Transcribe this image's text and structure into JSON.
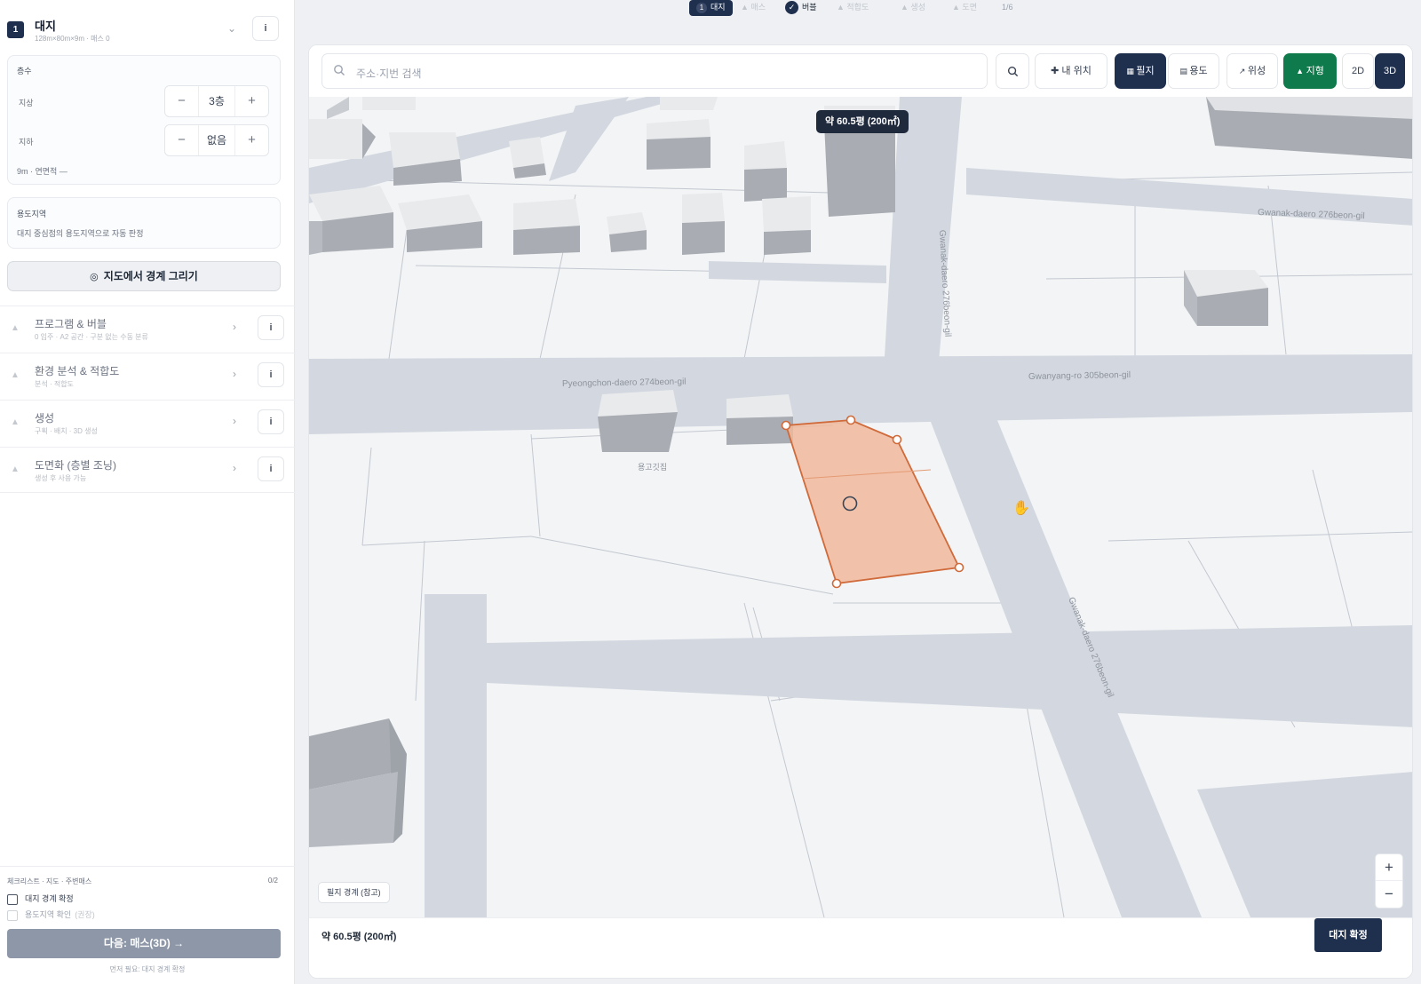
{
  "sidebar": {
    "step_number": "1",
    "section_title": "대지",
    "section_sub": "128m×80m×9m · 매스 0",
    "info_glyph": "i",
    "floors": {
      "title": "층수",
      "above_label": "지상",
      "above_value": "3층",
      "below_label": "지하",
      "below_value": "없음",
      "note": "9m · 연면적 —"
    },
    "zoning": {
      "title": "용도지역",
      "note": "대지 중심점의 용도지역으로 자동 판정"
    },
    "draw_button": "지도에서 경계 그리기",
    "nav_items": [
      {
        "title": "프로그램 & 버블",
        "sub": "0 입주 · A2 공간 · 구분 없는 수동 분류"
      },
      {
        "title": "환경 분석 & 적합도",
        "sub": "분석 · 적합도"
      },
      {
        "title": "생성",
        "sub": "구획 · 배치 · 3D 생성"
      },
      {
        "title": "도면화 (층별 조닝)",
        "sub": "생성 후 사용 가능"
      }
    ],
    "checklist": {
      "title": "체크리스트 · 지도 · 주변매스",
      "count": "0/2",
      "items": [
        {
          "label": "대지 경계 확정",
          "tag": ""
        },
        {
          "label": "용도지역 확인",
          "tag": "(권장)"
        }
      ]
    },
    "next_button": "다음: 매스(3D) →",
    "hint": "먼저 필요: 대지 경계 확정"
  },
  "steps": {
    "items": [
      "대지",
      "매스",
      "버블",
      "적합도",
      "생성",
      "도면"
    ],
    "counter": "1/6"
  },
  "toolbar": {
    "search_placeholder": "주소·지번 검색",
    "my_location": "내 위치",
    "layers": [
      "필지",
      "용도",
      "위성",
      "지형"
    ],
    "mode_2d": "2D",
    "mode_3d": "3D"
  },
  "map": {
    "area_tooltip": "약 60.5평 (200㎡)",
    "parcel_note": "필지 경계 (참고)",
    "street_labels": [
      "Pyeongchon-daero 274beon-gil",
      "Gwanyang-ro 305beon-gil",
      "Gwanak-daero 276beon-gil",
      "Gwanak-daero 276beon-gil",
      "Gwanak-daero 276beon-gil"
    ],
    "poi_label": "용고깃집",
    "zoom_in": "+",
    "zoom_out": "−",
    "polygon_color": "#f0b89b",
    "polygon_stroke": "#d06a3a"
  },
  "footer": {
    "area_text": "약 60.5평 (200㎡)",
    "confirm_button": "대지 확정"
  }
}
